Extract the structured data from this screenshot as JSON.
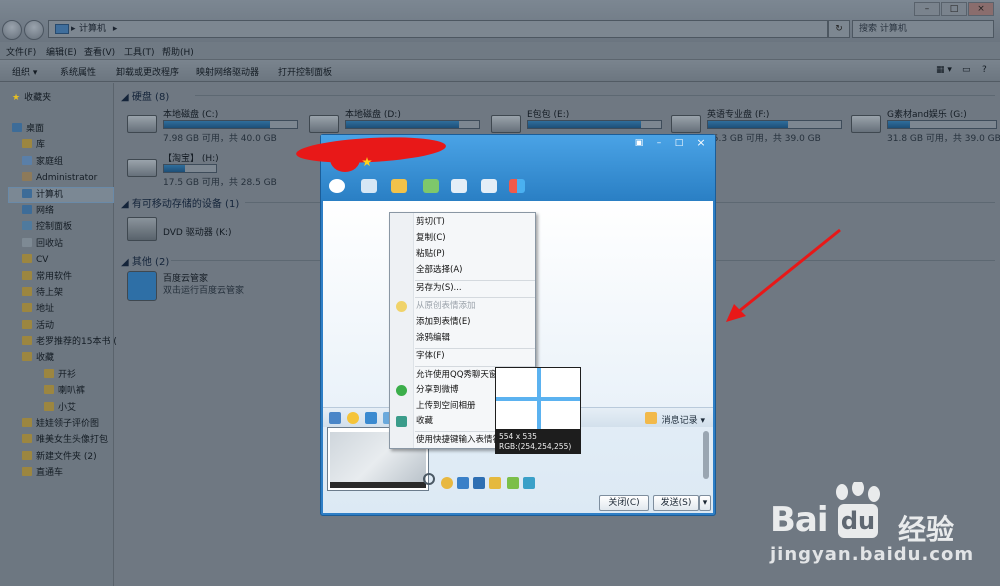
{
  "explorer": {
    "address": "计算机",
    "search_placeholder": "搜索 计算机",
    "menu": [
      "文件(F)",
      "编辑(E)",
      "查看(V)",
      "工具(T)",
      "帮助(H)"
    ],
    "toolbar": [
      "组织 ▾",
      "系统属性",
      "卸载或更改程序",
      "映射网络驱动器",
      "打开控制面板"
    ],
    "sidebar": {
      "favorites": "收藏夹",
      "desktop": "桌面",
      "items": [
        "库",
        "家庭组",
        "Administrator",
        "计算机",
        "网络",
        "控制面板",
        "回收站",
        "CV",
        "常用软件",
        "待上架",
        "地址",
        "活动",
        "老罗推荐的15本书 (",
        "收藏",
        "开衫",
        "喇叭裤",
        "小艾",
        "娃娃领子评价图",
        "唯美女生头像打包",
        "新建文件夹 (2)",
        "直通车"
      ]
    },
    "groups": {
      "hard_disks": "硬盘 (8)",
      "removable": "有可移动存储的设备 (1)",
      "other": "其他 (2)"
    },
    "drives": [
      {
        "name": "本地磁盘 (C:)",
        "info": "7.98 GB 可用，共 40.0 GB",
        "used": 0.8
      },
      {
        "name": "本地磁盘 (D:)",
        "info": "",
        "used": 0.85
      },
      {
        "name": "E包包 (E:)",
        "info": "",
        "used": 0.85
      },
      {
        "name": "英语专业盘 (F:)",
        "info": "15.3 GB 可用，共 39.0 GB",
        "used": 0.6
      },
      {
        "name": "G素材and娱乐 (G:)",
        "info": "31.8 GB 可用，共 39.0 GB",
        "used": 0.2
      },
      {
        "name": "【淘宝】 (H:)",
        "info": "17.5 GB 可用，共 28.5 GB",
        "used": 0.4
      }
    ],
    "dvd": "DVD 驱动器 (K:)",
    "other_app": {
      "name": "百度云管家",
      "desc": "双击运行百度云管家"
    }
  },
  "qq": {
    "msg_record": "消息记录 ▾",
    "close_btn": "关闭(C)",
    "send_btn": "发送(S)"
  },
  "context_menu": {
    "items": [
      {
        "label": "剪切(T)",
        "disabled": false
      },
      {
        "label": "复制(C)",
        "disabled": false
      },
      {
        "label": "粘贴(P)",
        "disabled": false
      },
      {
        "label": "全部选择(A)",
        "disabled": false
      },
      {
        "label": "另存为(S)...",
        "disabled": false
      },
      {
        "label": "从原创表情添加",
        "disabled": true
      },
      {
        "label": "添加到表情(E)",
        "disabled": false
      },
      {
        "label": "涂鸦编辑",
        "disabled": false
      },
      {
        "label": "字体(F)",
        "disabled": false
      },
      {
        "label": "允许使用QQ秀聊天窗",
        "disabled": false
      },
      {
        "label": "分享到微博",
        "disabled": false
      },
      {
        "label": "上传到空间相册",
        "disabled": false
      },
      {
        "label": "收藏",
        "disabled": false
      },
      {
        "label": "使用快捷键输入表情符",
        "disabled": false
      }
    ]
  },
  "magnifier": {
    "size": "554 x 535",
    "rgb": "RGB:(254,254,255)"
  },
  "watermark": {
    "brand": "Bai",
    "brand_suffix": "经验",
    "url": "jingyan.baidu.com"
  },
  "colors": {
    "qq_blue": "#2f7fc6",
    "arrow_red": "#e81818",
    "magnifier_cross": "#5bb2f0"
  }
}
